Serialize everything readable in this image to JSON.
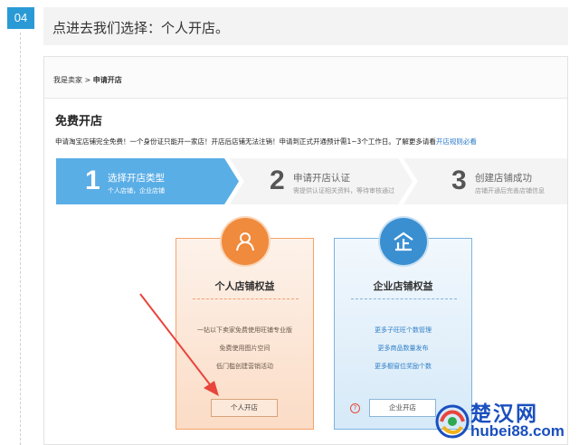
{
  "step": {
    "number": "04",
    "title": "点进去我们选择：个人开店。"
  },
  "breadcrumb": {
    "parent": "我是卖家",
    "separator": ">",
    "current": "申请开店"
  },
  "page": {
    "title": "免费开店",
    "notice": "申请淘宝店铺完全免费！一个身份证只能开一家店！开店后店铺无法注销！申请到正式开通预计需1~3个工作日。了解更多请看",
    "notice_link": "开店规则必看"
  },
  "progress_steps": [
    {
      "num": "1",
      "title": "选择开店类型",
      "sub": "个人店铺，企业店铺",
      "state": "active"
    },
    {
      "num": "2",
      "title": "申请开店认证",
      "sub": "需提供认证相关资料，等待审核通过",
      "state": "inactive"
    },
    {
      "num": "3",
      "title": "创建店铺成功",
      "sub": "店铺开通后完善店铺信息",
      "state": "inactive"
    }
  ],
  "cards": {
    "personal": {
      "title": "个人店铺权益",
      "benefits": [
        "一钻以下卖家免费使用旺铺专业版",
        "免费使用图片空间",
        "低门槛创建营销活动"
      ],
      "button": "个人开店",
      "icon": "person-icon"
    },
    "company": {
      "title": "企业店铺权益",
      "benefits": [
        "更多子旺旺个数管理",
        "更多商品数量发布",
        "更多橱窗位奖励个数"
      ],
      "button": "企业开店",
      "help": "?",
      "icon": "enterprise-icon"
    }
  },
  "watermark": {
    "cn": "楚汉网",
    "en": "hubei88.com"
  },
  "colors": {
    "accent_blue": "#2a9ad6",
    "step_active": "#5aaee6",
    "orange": "#f08a3c",
    "blue": "#3a8fd1",
    "arrow_red": "#e8453c"
  }
}
